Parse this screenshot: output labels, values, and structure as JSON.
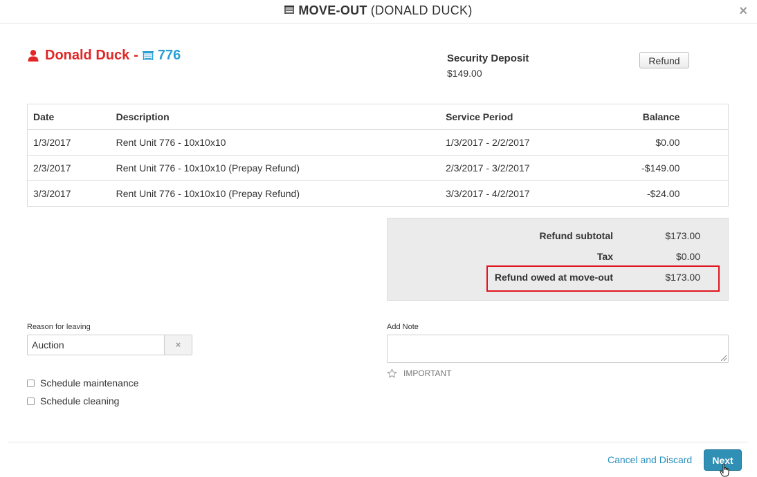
{
  "modal": {
    "title_main": "MOVE-OUT",
    "title_sub": "(DONALD DUCK)",
    "close_symbol": "×"
  },
  "customer": {
    "name": "Donald Duck",
    "separator": "-",
    "unit": "776",
    "name_color": "#e02626",
    "unit_color": "#2a9fd6"
  },
  "deposit": {
    "label": "Security Deposit",
    "value": "$149.00",
    "refund_label": "Refund"
  },
  "ledger": {
    "headers": [
      "Date",
      "Description",
      "Service Period",
      "Balance"
    ],
    "rows": [
      [
        "1/3/2017",
        "Rent Unit 776 - 10x10x10",
        "1/3/2017 - 2/2/2017",
        "$0.00"
      ],
      [
        "2/3/2017",
        "Rent Unit 776 - 10x10x10 (Prepay Refund)",
        "2/3/2017 - 3/2/2017",
        "-$149.00"
      ],
      [
        "3/3/2017",
        "Rent Unit 776 - 10x10x10 (Prepay Refund)",
        "3/3/2017 - 4/2/2017",
        "-$24.00"
      ]
    ]
  },
  "totals": {
    "subtotal_label": "Refund subtotal",
    "subtotal_value": "$173.00",
    "tax_label": "Tax",
    "tax_value": "$0.00",
    "owed_label": "Refund owed at move-out",
    "owed_value": "$173.00",
    "highlight_color": "#e0141e"
  },
  "reason": {
    "label": "Reason for leaving",
    "value": "Auction",
    "clear_symbol": "×"
  },
  "options": {
    "maintenance_label": "Schedule maintenance",
    "cleaning_label": "Schedule cleaning"
  },
  "note": {
    "label": "Add Note",
    "value": "",
    "important_label": "IMPORTANT"
  },
  "footer": {
    "cancel_label": "Cancel and Discard",
    "next_label": "Next",
    "accent_color": "#2f8fb4"
  },
  "icons": {
    "title": "storage-unit-icon",
    "customer": "user-icon",
    "unit": "storage-unit-icon",
    "important": "star-icon",
    "cursor": "hand-pointer-icon"
  }
}
